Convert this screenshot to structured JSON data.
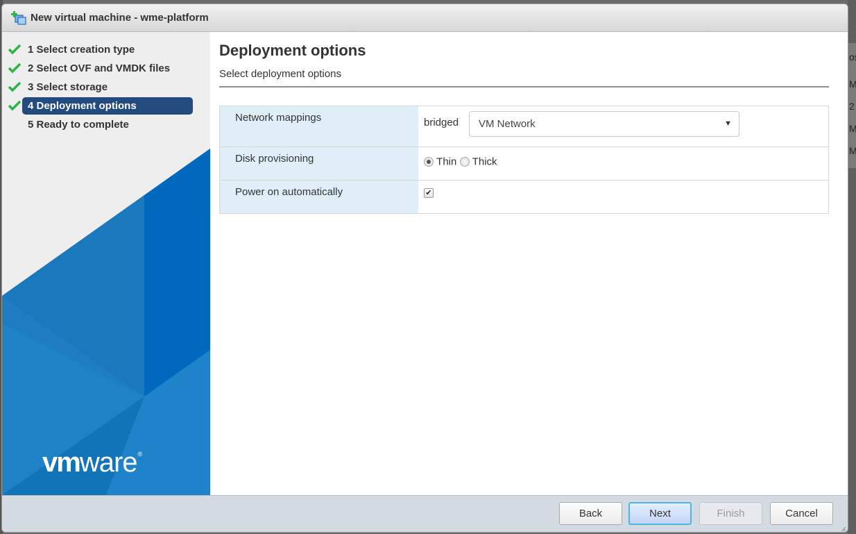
{
  "window": {
    "title": "New virtual machine - wme-platform",
    "icon": "new-vm-icon"
  },
  "wizard_steps": [
    {
      "label": "1 Select creation type",
      "completed": true,
      "active": false
    },
    {
      "label": "2 Select OVF and VMDK files",
      "completed": true,
      "active": false
    },
    {
      "label": "3 Select storage",
      "completed": true,
      "active": false
    },
    {
      "label": "4 Deployment options",
      "completed": true,
      "active": true
    },
    {
      "label": "5 Ready to complete",
      "completed": false,
      "active": false
    }
  ],
  "brand": {
    "logo_vm": "vm",
    "logo_ware": "ware",
    "logo_reg": "®"
  },
  "page": {
    "heading": "Deployment options",
    "subheading": "Select deployment options"
  },
  "options": {
    "network": {
      "label": "Network mappings",
      "source": "bridged",
      "selected": "VM Network"
    },
    "disk": {
      "label": "Disk provisioning",
      "choices": [
        "Thin",
        "Thick"
      ],
      "selected": "Thin"
    },
    "power": {
      "label": "Power on automatically",
      "checked": true,
      "check_glyph": "✔"
    }
  },
  "footer": {
    "back": "Back",
    "next": "Next",
    "finish": "Finish",
    "cancel": "Cancel"
  },
  "background_app": {
    "column_fragments": [
      "os",
      "M",
      "2",
      "M",
      "M"
    ]
  },
  "colors": {
    "active_step_bg": "#234b7e",
    "check_green": "#2fb344",
    "label_cell_bg": "#e0eef7",
    "next_focus": "#4bb7e0"
  }
}
